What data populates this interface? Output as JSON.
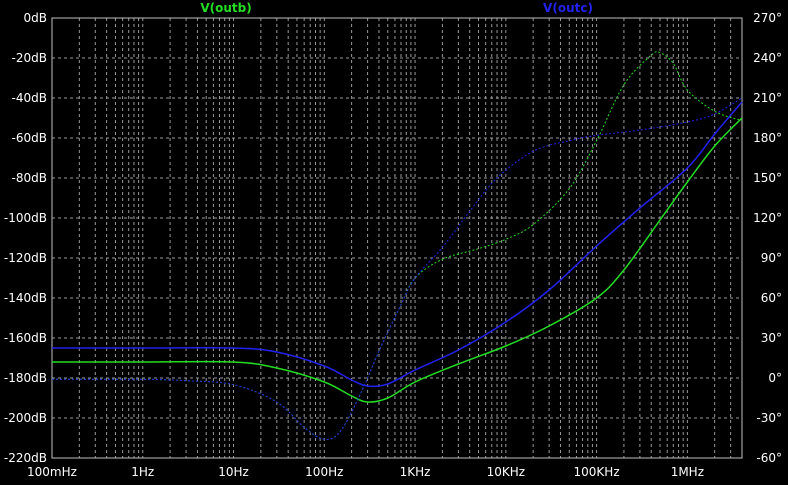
{
  "chart_data": {
    "type": "line",
    "x_scale": "log",
    "xlim": [
      0.1,
      4000000
    ],
    "ylim_left": [
      -220,
      0
    ],
    "ylim_right": [
      -60,
      270
    ],
    "grid": true,
    "x_ticks": [
      {
        "v": 0.1,
        "label": "100mHz"
      },
      {
        "v": 1,
        "label": "1Hz"
      },
      {
        "v": 10,
        "label": "10Hz"
      },
      {
        "v": 100,
        "label": "100Hz"
      },
      {
        "v": 1000,
        "label": "1KHz"
      },
      {
        "v": 10000,
        "label": "10KHz"
      },
      {
        "v": 100000,
        "label": "100KHz"
      },
      {
        "v": 1000000,
        "label": "1MHz"
      }
    ],
    "y_left_ticks": [
      {
        "v": 0,
        "label": "0dB"
      },
      {
        "v": -20,
        "label": "-20dB"
      },
      {
        "v": -40,
        "label": "-40dB"
      },
      {
        "v": -60,
        "label": "-60dB"
      },
      {
        "v": -80,
        "label": "-80dB"
      },
      {
        "v": -100,
        "label": "-100dB"
      },
      {
        "v": -120,
        "label": "-120dB"
      },
      {
        "v": -140,
        "label": "-140dB"
      },
      {
        "v": -160,
        "label": "-160dB"
      },
      {
        "v": -180,
        "label": "-180dB"
      },
      {
        "v": -200,
        "label": "-200dB"
      },
      {
        "v": -220,
        "label": "-220dB"
      }
    ],
    "y_right_ticks": [
      {
        "v": 270,
        "label": "270°"
      },
      {
        "v": 240,
        "label": "240°"
      },
      {
        "v": 210,
        "label": "210°"
      },
      {
        "v": 180,
        "label": "180°"
      },
      {
        "v": 150,
        "label": "150°"
      },
      {
        "v": 120,
        "label": "120°"
      },
      {
        "v": 90,
        "label": "90°"
      },
      {
        "v": 60,
        "label": "60°"
      },
      {
        "v": 30,
        "label": "30°"
      },
      {
        "v": 0,
        "label": "0°"
      },
      {
        "v": -30,
        "label": "-30°"
      },
      {
        "v": -60,
        "label": "-60°"
      }
    ],
    "series": [
      {
        "name": "V(outb)",
        "color": "#22dd22",
        "legend_pos": "top-left",
        "magnitude_db": [
          [
            0.1,
            -172
          ],
          [
            1,
            -172
          ],
          [
            10,
            -172
          ],
          [
            30,
            -175
          ],
          [
            100,
            -182
          ],
          [
            200,
            -189
          ],
          [
            300,
            -192
          ],
          [
            500,
            -190
          ],
          [
            1000,
            -182
          ],
          [
            3000,
            -173
          ],
          [
            10000,
            -164
          ],
          [
            30000,
            -154
          ],
          [
            100000,
            -140
          ],
          [
            200000,
            -126
          ],
          [
            500000,
            -101
          ],
          [
            1000000,
            -82
          ],
          [
            2000000,
            -64
          ],
          [
            4000000,
            -50
          ]
        ],
        "phase_deg": [
          [
            0.1,
            -1
          ],
          [
            1,
            -1
          ],
          [
            3,
            -2
          ],
          [
            10,
            -5
          ],
          [
            30,
            -18
          ],
          [
            60,
            -37
          ],
          [
            100,
            -46
          ],
          [
            150,
            -40
          ],
          [
            250,
            -12
          ],
          [
            400,
            20
          ],
          [
            700,
            55
          ],
          [
            1000,
            75
          ],
          [
            2000,
            89
          ],
          [
            5000,
            97
          ],
          [
            10000,
            104
          ],
          [
            20000,
            115
          ],
          [
            50000,
            142
          ],
          [
            100000,
            178
          ],
          [
            200000,
            220
          ],
          [
            400000,
            242
          ],
          [
            500000,
            244
          ],
          [
            700000,
            236
          ],
          [
            1000000,
            216
          ],
          [
            2000000,
            200
          ],
          [
            4000000,
            193
          ]
        ]
      },
      {
        "name": "V(outc)",
        "color": "#2222ee",
        "legend_pos": "top-right",
        "magnitude_db": [
          [
            0.1,
            -165
          ],
          [
            1,
            -165
          ],
          [
            10,
            -165
          ],
          [
            30,
            -167
          ],
          [
            100,
            -174
          ],
          [
            200,
            -181
          ],
          [
            300,
            -184
          ],
          [
            500,
            -183
          ],
          [
            1000,
            -176
          ],
          [
            3000,
            -166
          ],
          [
            10000,
            -152
          ],
          [
            30000,
            -136
          ],
          [
            100000,
            -114
          ],
          [
            300000,
            -95
          ],
          [
            1000000,
            -75
          ],
          [
            2000000,
            -58
          ],
          [
            4000000,
            -42
          ]
        ],
        "phase_deg": [
          [
            0.1,
            -1
          ],
          [
            1,
            -1
          ],
          [
            3,
            -2
          ],
          [
            10,
            -5
          ],
          [
            30,
            -18
          ],
          [
            60,
            -37
          ],
          [
            100,
            -46
          ],
          [
            150,
            -40
          ],
          [
            250,
            -12
          ],
          [
            400,
            20
          ],
          [
            700,
            55
          ],
          [
            1000,
            75
          ],
          [
            2000,
            98
          ],
          [
            4000,
            125
          ],
          [
            8000,
            150
          ],
          [
            20000,
            170
          ],
          [
            50000,
            178
          ],
          [
            100000,
            182
          ],
          [
            300000,
            186
          ],
          [
            1000000,
            192
          ],
          [
            2000000,
            198
          ],
          [
            4000000,
            210
          ]
        ]
      }
    ]
  }
}
